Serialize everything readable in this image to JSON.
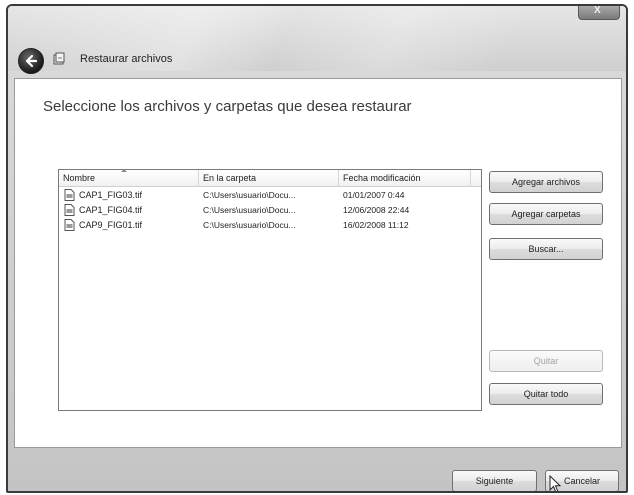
{
  "window": {
    "title": "Restaurar archivos",
    "close_label": "X"
  },
  "content": {
    "heading": "Seleccione los archivos y carpetas que desea restaurar"
  },
  "file_list": {
    "columns": [
      "Nombre",
      "En la carpeta",
      "Fecha modificación"
    ],
    "rows": [
      {
        "name": "CAP1_FIG03.tif",
        "folder": "C:\\Users\\usuario\\Docu...",
        "modified": "01/01/2007 0:44"
      },
      {
        "name": "CAP1_FIG04.tif",
        "folder": "C:\\Users\\usuario\\Docu...",
        "modified": "12/06/2008 22:44"
      },
      {
        "name": "CAP9_FIG01.tif",
        "folder": "C:\\Users\\usuario\\Docu...",
        "modified": "16/02/2008 11:12"
      }
    ]
  },
  "side_buttons": {
    "add_files": "Agregar archivos",
    "add_folders": "Agregar carpetas",
    "search": "Buscar...",
    "remove": "Quitar",
    "remove_all": "Quitar todo"
  },
  "footer": {
    "next": "Siguiente",
    "cancel": "Cancelar"
  },
  "icons": {
    "back": "back-arrow-icon",
    "app": "restore-files-icon",
    "file": "tif-file-icon",
    "cursor": "mouse-pointer-icon"
  }
}
